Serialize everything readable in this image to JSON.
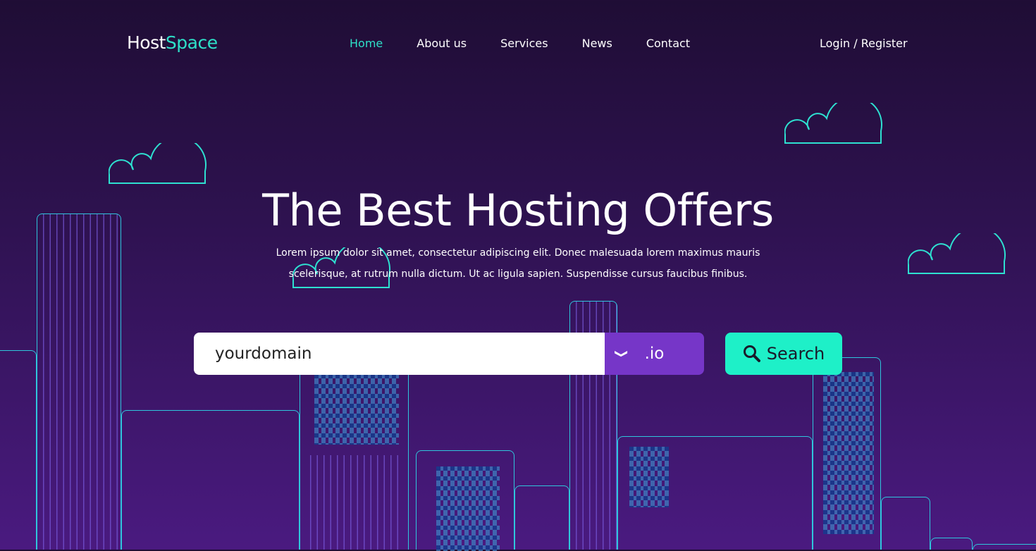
{
  "brand": {
    "part1": "Host",
    "part2": "Space"
  },
  "nav": [
    {
      "label": "Home",
      "active": true
    },
    {
      "label": "About us"
    },
    {
      "label": "Services"
    },
    {
      "label": "News"
    },
    {
      "label": "Contact"
    }
  ],
  "login": "Login / Register",
  "hero": {
    "title": "The Best Hosting Offers",
    "subtitle": "Lorem ipsum dolor sit amet, consectetur adipiscing elit. Donec malesuada lorem maximus mauris scelerisque, at rutrum nulla dictum. Ut ac ligula sapien. Suspendisse cursus faucibus finibus."
  },
  "search": {
    "value": "yourdomain",
    "tld": ".io",
    "button": "Search",
    "icon": "search-icon"
  },
  "colors": {
    "accent": "#1ef0c8",
    "tld_bg": "#7636c8",
    "outline": "#2fc6dc"
  }
}
